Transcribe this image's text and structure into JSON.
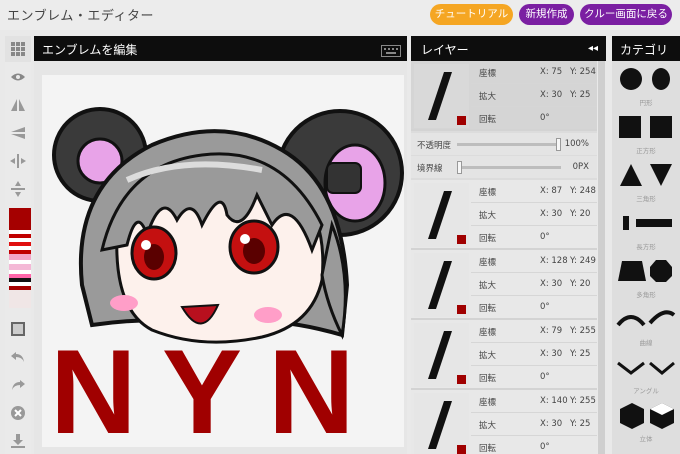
{
  "app": {
    "title": "エンブレム・エディター"
  },
  "buttons": {
    "tutorial": "チュートリアル",
    "new": "新規作成",
    "back": "クルー画面に戻る"
  },
  "editor": {
    "title": "エンブレムを編集",
    "canvas_text": [
      "N",
      "Y",
      "N"
    ]
  },
  "palette": {
    "swatches": [
      "#a50000",
      "#ffffff",
      "#c00000",
      "#ffffff",
      "#e01010",
      "#ffffff",
      "#c00000",
      "#f3a6c9",
      "#ffffff",
      "#f4b8d6",
      "#ffffff",
      "#ff66aa",
      "#111111",
      "#ffffff",
      "#a50000",
      "#f0e6e6"
    ]
  },
  "layers": {
    "title": "レイヤー",
    "labels": {
      "position": "座標",
      "scale": "拡大",
      "rotation": "回転"
    },
    "opacity": {
      "label": "不透明度",
      "value": "100%",
      "level": 1.0
    },
    "border": {
      "label": "境界線",
      "value": "0PX",
      "level": 0.0
    },
    "items": [
      {
        "x": "X: 75",
        "y": "Y: 254",
        "sx": "X: 30",
        "sy": "Y: 25",
        "rot": "0°"
      },
      {
        "x": "X: 87",
        "y": "Y: 248",
        "sx": "X: 30",
        "sy": "Y: 20",
        "rot": "0°"
      },
      {
        "x": "X: 128",
        "y": "Y: 249",
        "sx": "X: 30",
        "sy": "Y: 20",
        "rot": "0°"
      },
      {
        "x": "X: 79",
        "y": "Y: 255",
        "sx": "X: 30",
        "sy": "Y: 25",
        "rot": "0°"
      },
      {
        "x": "X: 140",
        "y": "Y: 255",
        "sx": "X: 30",
        "sy": "Y: 25",
        "rot": "0°"
      }
    ]
  },
  "categories": {
    "title": "カテゴリ",
    "items": [
      "円形",
      "正方形",
      "三角形",
      "長方形",
      "多角形",
      "曲線",
      "アングル",
      "立体"
    ]
  },
  "colors": {
    "accent_orange": "#f5a623",
    "accent_purple": "#7b1fa2",
    "emblem_red": "#a00000"
  }
}
